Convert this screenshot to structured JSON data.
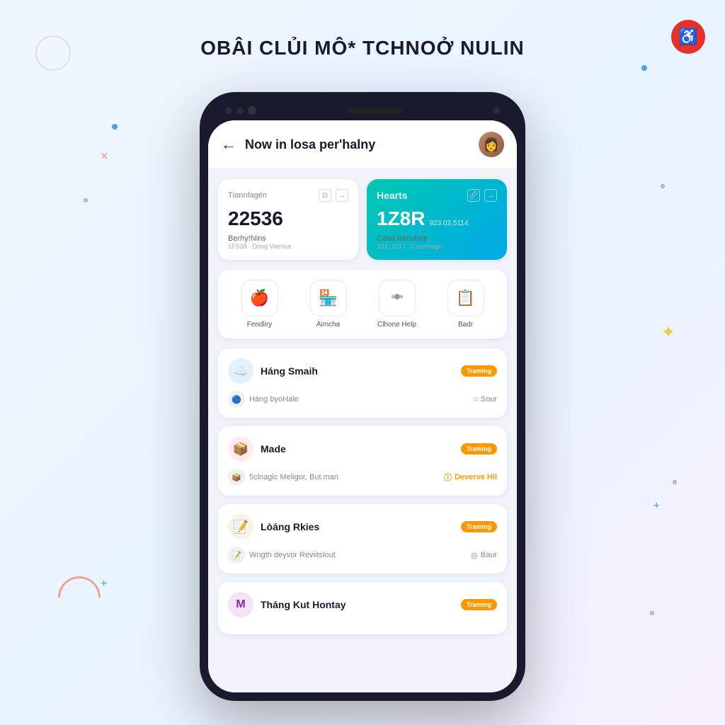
{
  "page": {
    "title": "OBÂI CLỦI MÔ* TCHNOỞ NULIN",
    "bg_decorations": true
  },
  "top_icon": {
    "symbol": "♿",
    "color": "#e8302a"
  },
  "phone": {
    "header": {
      "back_label": "←",
      "title": "Now in losa per'halny",
      "avatar_emoji": "👩"
    },
    "cards": [
      {
        "id": "card-white",
        "label": "Tịannfagén",
        "number": "22536",
        "meta": "Berhy!Nins",
        "meta_sub": "1FS38 · Dong Viemua",
        "icon1": "⊡",
        "icon2": "→"
      },
      {
        "id": "card-teal",
        "label": "Hearts",
        "number": "1Z8R",
        "sub_number": "923.02.5114",
        "meta": "Calai Recuhde",
        "meta_sub": "3S1, 2017 · Csremiogn",
        "icon1": "🔗",
        "icon2": "→"
      }
    ],
    "actions": [
      {
        "icon": "🍎",
        "label": "Fendliry"
      },
      {
        "icon": "🏪",
        "label": "Aimcha"
      },
      {
        "icon": "⚙️",
        "label": "Clhone Help"
      },
      {
        "icon": "📋",
        "label": "Badr"
      }
    ],
    "list_items": [
      {
        "icon_type": "blue",
        "icon_emoji": "☁️",
        "title": "Háng Smaih",
        "badge": "Traming",
        "sub_icon": "🔵",
        "sub_text": "Háng byoHale",
        "sub_right_text": "Sour",
        "sub_right_class": ""
      },
      {
        "icon_type": "red",
        "icon_emoji": "📦",
        "title": "Made",
        "badge": "Traming",
        "sub_icon": "📦",
        "sub_text": "5clnagic Meligor, But man",
        "sub_right_text": "Deverve Hil",
        "sub_right_class": "orange"
      },
      {
        "icon_type": "orange",
        "icon_emoji": "📝",
        "title": "Lòáng Rkies",
        "badge": "Traming",
        "sub_icon": "📝",
        "sub_text": "Wngth deyvor Reviitslout",
        "sub_right_text": "Baur",
        "sub_right_class": ""
      },
      {
        "icon_type": "purple",
        "icon_emoji": "M",
        "title": "Tháng Kut Hontay",
        "badge": "Traming",
        "sub_icon": "",
        "sub_text": "",
        "sub_right_text": "",
        "sub_right_class": ""
      }
    ]
  }
}
